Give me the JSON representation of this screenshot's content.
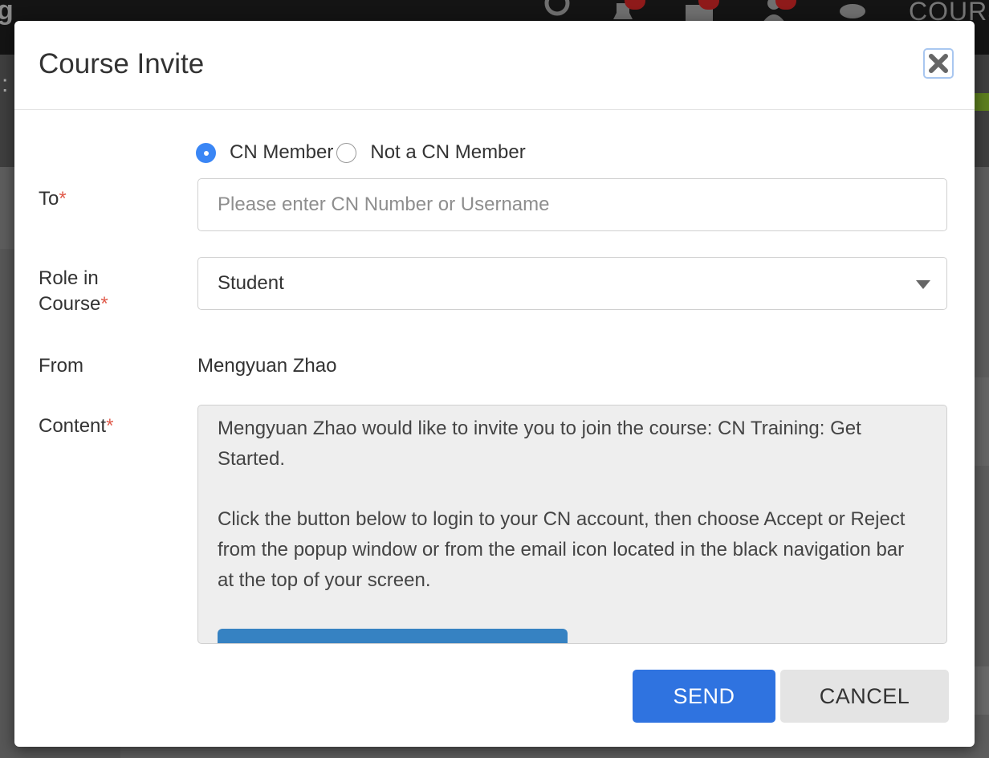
{
  "background": {
    "logo_fragment": "g",
    "nav_text": "COURS"
  },
  "modal": {
    "title": "Course Invite",
    "recipient_type": {
      "options": [
        "CN Member",
        "Not a CN Member"
      ],
      "selected": "CN Member"
    },
    "to": {
      "label": "To",
      "required_mark": "*",
      "placeholder": "Please enter CN Number or Username",
      "value": ""
    },
    "role": {
      "label_line1": "Role in",
      "label_line2": "Course",
      "required_mark": "*",
      "selected": "Student"
    },
    "from": {
      "label": "From",
      "value": "Mengyuan Zhao"
    },
    "content": {
      "label": "Content",
      "required_mark": "*",
      "paragraph1": "Mengyuan Zhao would like to invite you to join the course: CN Training: Get Started.",
      "paragraph2": "Click the button below to login to your CN account, then choose Accept or Reject from the popup window or from the email icon located in the black navigation bar at the top of your screen."
    },
    "buttons": {
      "send": "SEND",
      "cancel": "CANCEL"
    }
  },
  "icons": {
    "close": "close-icon",
    "dropdown": "chevron-down-icon",
    "search": "search-icon",
    "notifications": "bell-icon",
    "mail": "mail-icon",
    "add_user": "add-user-icon",
    "chat": "chat-icon"
  },
  "colors": {
    "primary": "#2f73e0",
    "radio_selected": "#3a86f5",
    "required": "#e05b4b",
    "content_button": "#3682c2"
  }
}
